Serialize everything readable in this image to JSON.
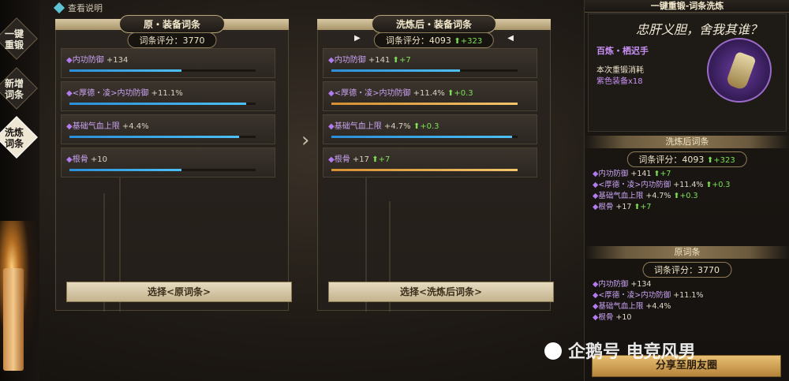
{
  "nav": {
    "items": [
      {
        "label": "一键\n重锻",
        "active": false
      },
      {
        "label": "新增\n词条",
        "active": false
      },
      {
        "label": "洗炼\n词条",
        "active": true
      }
    ]
  },
  "help_label": "查看说明",
  "original": {
    "title": "原・装备词条",
    "score_label": "词条评分：3770",
    "attrs": [
      {
        "name": "内功防御",
        "value": "+134",
        "bar": 0.6,
        "bar_color": "blue"
      },
      {
        "name": "<厚德・凌>内功防御",
        "value": "+11.1%",
        "bar": 0.95,
        "bar_color": "blue"
      },
      {
        "name": "基础气血上限",
        "value": "+4.4%",
        "bar": 0.91,
        "bar_color": "blue"
      },
      {
        "name": "根骨",
        "value": "+10",
        "bar": 0.6,
        "bar_color": "blue"
      }
    ],
    "select_label": "选择<原词条>"
  },
  "refined": {
    "title": "洗炼后・装备词条",
    "score_label": "词条评分：4093",
    "score_delta": "+323",
    "attrs": [
      {
        "name": "内功防御",
        "value": "+141",
        "delta": "+7",
        "bar": 0.69,
        "bar_color": "blue"
      },
      {
        "name": "<厚德・凌>内功防御",
        "value": "+11.4%",
        "delta": "+0.3",
        "bar": 1.0,
        "bar_color": "gold"
      },
      {
        "name": "基础气血上限",
        "value": "+4.7%",
        "delta": "+0.3",
        "bar": 0.97,
        "bar_color": "blue"
      },
      {
        "name": "根骨",
        "value": "+17",
        "delta": "+7",
        "bar": 1.0,
        "bar_color": "gold"
      }
    ],
    "select_label": "选择<洗炼后词条>"
  },
  "sidepanel": {
    "header": "一键重锻-词条洗炼",
    "motto": "忠肝义胆，舍我其谁？",
    "item_name": "百炼・栖迟手",
    "cost_label": "本次重锻消耗",
    "cost_value": "紫色装备x18",
    "refined_section": "洗炼后词条",
    "refined_score": "词条评分：4093",
    "refined_delta": "+323",
    "refined_lines": [
      {
        "name": "内功防御",
        "value": "+141",
        "delta": "+7"
      },
      {
        "name": "<厚德・凌>内功防御",
        "value": "+11.4%",
        "delta": "+0.3"
      },
      {
        "name": "基础气血上限",
        "value": "+4.7%",
        "delta": "+0.3"
      },
      {
        "name": "根骨",
        "value": "+17",
        "delta": "+7"
      }
    ],
    "original_section": "原词条",
    "original_score": "词条评分：3770",
    "original_lines": [
      {
        "name": "内功防御",
        "value": "+134"
      },
      {
        "name": "<厚德・凌>内功防御",
        "value": "+11.1%"
      },
      {
        "name": "基础气血上限",
        "value": "+4.4%"
      },
      {
        "name": "根骨",
        "value": "+10"
      }
    ],
    "share_label": "分享至朋友圈"
  },
  "watermark": "企鹅号 电竞风男"
}
